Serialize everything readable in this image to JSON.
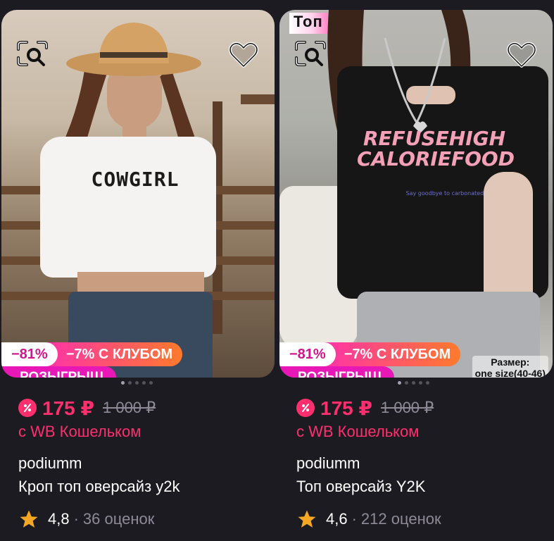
{
  "products": [
    {
      "discount_badge": "−81%",
      "club_badge": "−7% С КЛУБОМ",
      "raffle_badge": "РОЗЫГРЫШ",
      "shirt_print": "COWGIRL",
      "price": "175 ₽",
      "old_price": "1 000 ₽",
      "wallet_note": "с WB Кошельком",
      "brand": "podiumm",
      "title": "Кроп топ оверсайз y2k",
      "rating": "4,8",
      "separator": "·",
      "reviews": "36 оценок",
      "carousel_dots": 5,
      "carousel_active": 0
    },
    {
      "top_label": "Топ",
      "discount_badge": "−81%",
      "club_badge": "−7% С КЛУБОМ",
      "raffle_badge": "РОЗЫГРЫШ",
      "size_label": "Размер:",
      "size_value": "one size(40-46)",
      "shirt_print": "REFUSEHIGH CALORIEFOOD",
      "shirt_small_print": "Say goodbye to carbonated food",
      "price": "175 ₽",
      "old_price": "1 000 ₽",
      "wallet_note": "с WB Кошельком",
      "brand": "podiumm",
      "title": "Топ оверсайз Y2K",
      "rating": "4,6",
      "separator": "·",
      "reviews": "212 оценок",
      "carousel_dots": 5,
      "carousel_active": 0
    }
  ],
  "colors": {
    "background": "#1c1b21",
    "price": "#ff2f6e",
    "muted": "#8e8a97",
    "raffle": "#e718b6",
    "club_gradient_start": "#ff33a8",
    "club_gradient_end": "#ff7a2b",
    "star": "#f5a623"
  },
  "icons": {
    "search": "image-search-icon",
    "favorite": "heart-outline-icon",
    "price": "percent-badge-icon",
    "rating": "star-icon"
  }
}
